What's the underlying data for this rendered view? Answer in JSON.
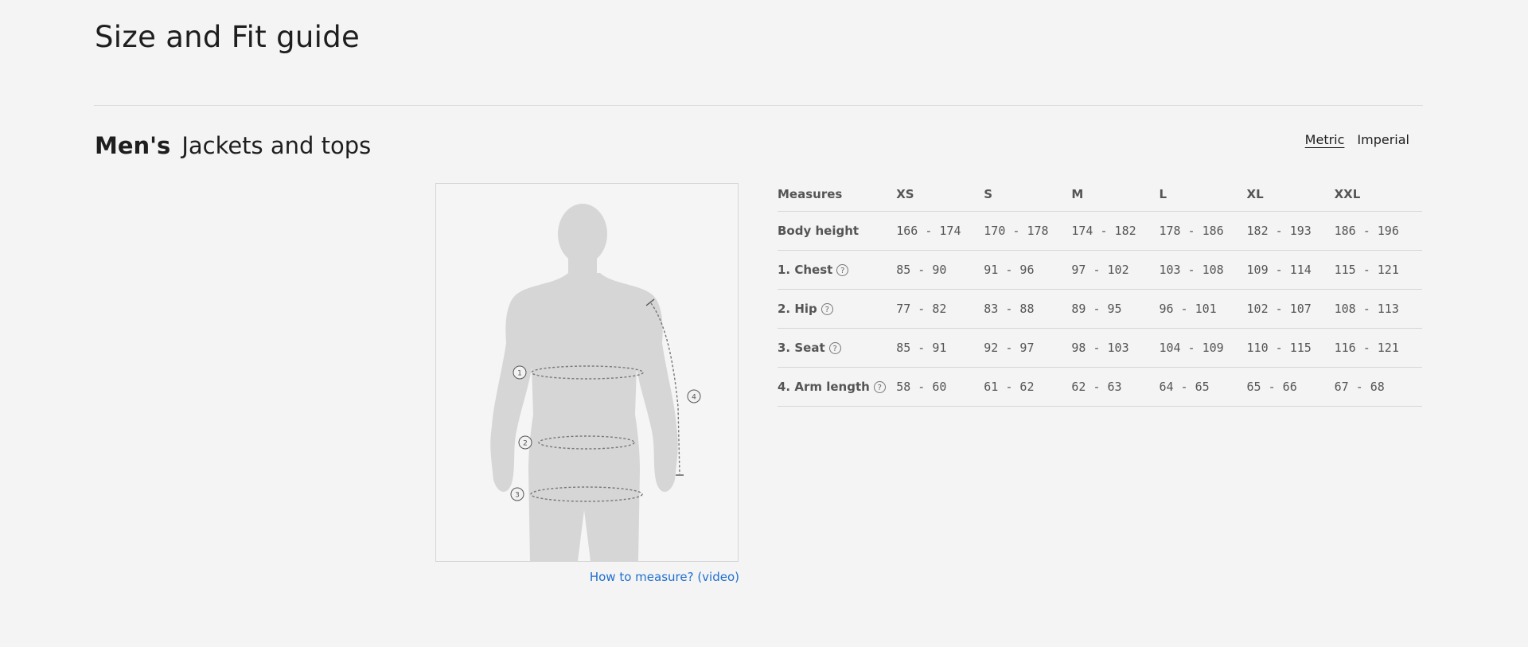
{
  "header": {
    "title": "Size and Fit guide"
  },
  "section": {
    "gender": "Men's",
    "category": "Jackets and tops"
  },
  "units": {
    "metric": "Metric",
    "imperial": "Imperial",
    "active": "metric"
  },
  "figure": {
    "markers": [
      "1",
      "2",
      "3",
      "4"
    ],
    "link": "How to measure? (video)"
  },
  "table": {
    "columns": [
      "Measures",
      "XS",
      "S",
      "M",
      "L",
      "XL",
      "XXL"
    ],
    "rows": [
      {
        "label": "Body height",
        "help": false,
        "values": [
          "166 - 174",
          "170 - 178",
          "174 - 182",
          "178 - 186",
          "182 - 193",
          "186 - 196"
        ]
      },
      {
        "label": "1. Chest",
        "help": true,
        "values": [
          "85 - 90",
          "91 - 96",
          "97 - 102",
          "103 - 108",
          "109 - 114",
          "115 - 121"
        ]
      },
      {
        "label": "2. Hip",
        "help": true,
        "values": [
          "77 - 82",
          "83 - 88",
          "89 - 95",
          "96 - 101",
          "102 - 107",
          "108 - 113"
        ]
      },
      {
        "label": "3. Seat",
        "help": true,
        "values": [
          "85 - 91",
          "92 - 97",
          "98 - 103",
          "104 - 109",
          "110 - 115",
          "116 - 121"
        ]
      },
      {
        "label": "4. Arm length",
        "help": true,
        "values": [
          "58 - 60",
          "61 - 62",
          "62 - 63",
          "64 - 65",
          "65 - 66",
          "67 - 68"
        ]
      }
    ]
  },
  "icons": {
    "help": "question-circle-icon",
    "help_glyph": "?"
  },
  "colors": {
    "link": "#1f6fcf",
    "silhouette": "#d6d6d6",
    "background": "#f4f4f4"
  }
}
